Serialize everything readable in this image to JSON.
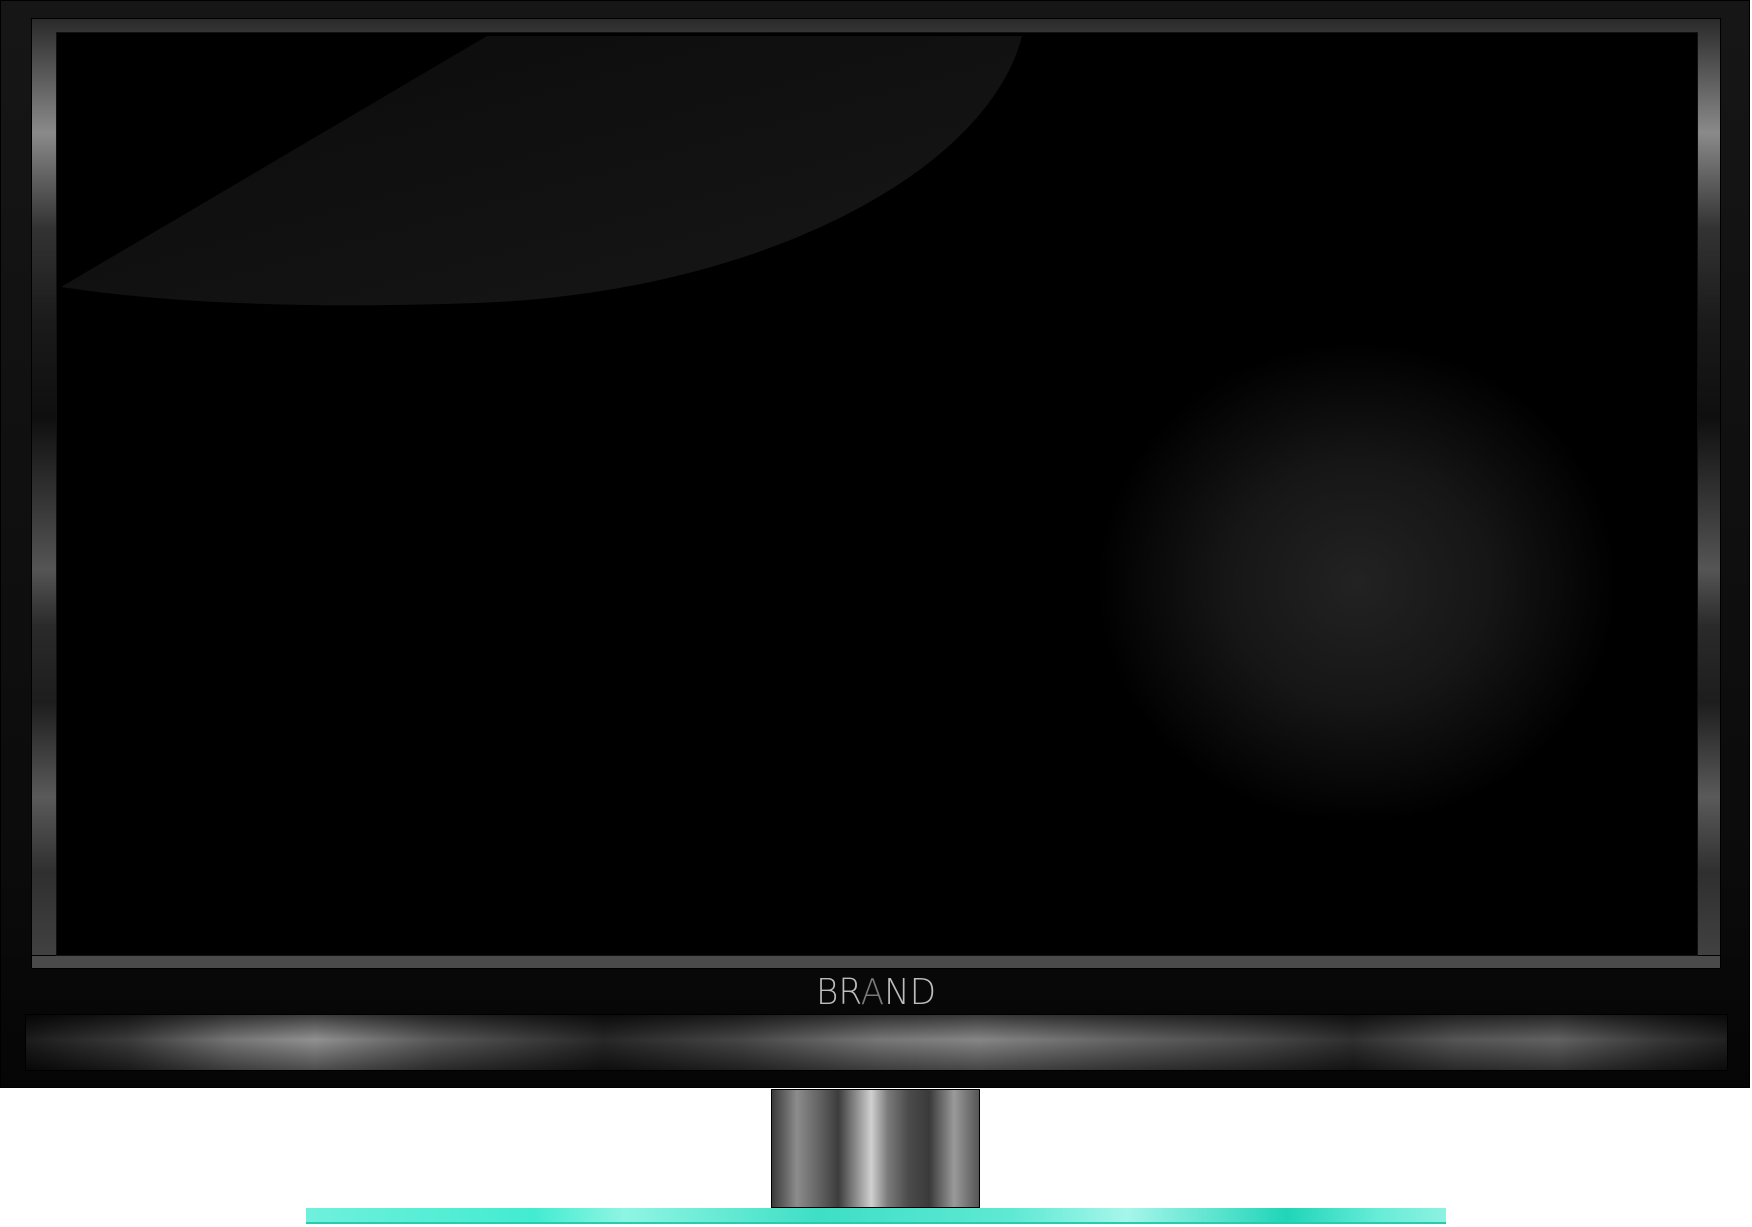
{
  "tv": {
    "brand_label": {
      "part1": "BR",
      "part2": "A",
      "part3": "ND"
    },
    "screen_color": "#000000",
    "bezel_color": "#0c0c0c",
    "base_color": "#42ecd0"
  }
}
